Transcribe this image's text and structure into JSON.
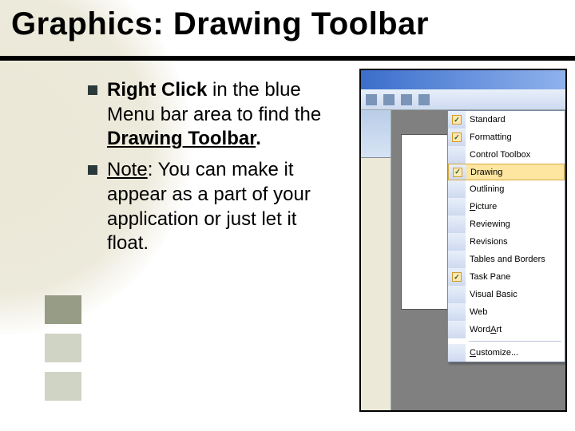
{
  "title": "Graphics:  Drawing Toolbar",
  "bullets": [
    {
      "lead_bold": "Right Click",
      "mid": " in the blue Menu bar area to find the ",
      "tail_bold_underline": "Drawing Toolbar",
      "period": "."
    },
    {
      "lead_underline": "Note",
      "rest": ":  You can make it appear as a part of your application or just let it float."
    }
  ],
  "menu": {
    "items": [
      {
        "label": "Standard",
        "checked": true,
        "highlight": false,
        "u": ""
      },
      {
        "label": "Formatting",
        "checked": true,
        "highlight": false,
        "u": ""
      },
      {
        "label": "Control Toolbox",
        "checked": false,
        "highlight": false,
        "u": ""
      },
      {
        "label": "Drawing",
        "checked": true,
        "highlight": true,
        "u": ""
      },
      {
        "label": "Outlining",
        "checked": false,
        "highlight": false,
        "u": ""
      },
      {
        "label": "Picture",
        "checked": false,
        "highlight": false,
        "u": "P"
      },
      {
        "label": "Reviewing",
        "checked": false,
        "highlight": false,
        "u": ""
      },
      {
        "label": "Revisions",
        "checked": false,
        "highlight": false,
        "u": ""
      },
      {
        "label": "Tables and Borders",
        "checked": false,
        "highlight": false,
        "u": ""
      },
      {
        "label": "Task Pane",
        "checked": true,
        "highlight": false,
        "u": ""
      },
      {
        "label": "Visual Basic",
        "checked": false,
        "highlight": false,
        "u": ""
      },
      {
        "label": "Web",
        "checked": false,
        "highlight": false,
        "u": ""
      },
      {
        "label": "WordArt",
        "checked": false,
        "highlight": false,
        "u": "A"
      },
      {
        "label": "Customize...",
        "checked": false,
        "highlight": false,
        "u": "C",
        "sep_before": true
      }
    ]
  }
}
